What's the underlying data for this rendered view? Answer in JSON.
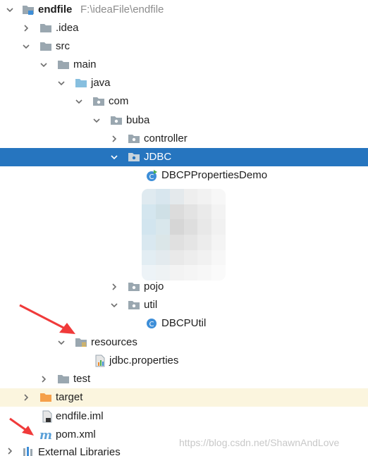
{
  "project": {
    "name": "endfile",
    "path": "F:\\ideaFile\\endfile"
  },
  "tree": {
    "idea": ".idea",
    "src": "src",
    "main": "main",
    "java": "java",
    "com": "com",
    "buba": "buba",
    "controller": "controller",
    "jdbc": "JDBC",
    "dbcp_demo": "DBCPPropertiesDemo",
    "pojo": "pojo",
    "util": "util",
    "dbcp_util": "DBCPUtil",
    "resources": "resources",
    "jdbc_properties": "jdbc.properties",
    "test": "test",
    "target": "target",
    "iml": "endfile.iml",
    "pom": "pom.xml",
    "external_libraries": "External Libraries"
  },
  "selected_item": "JDBC",
  "watermark": "https://blog.csdn.net/ShawnAndLove",
  "colors": {
    "selection": "#2675bf",
    "folder": "#9aa7b0",
    "source_folder": "#87bfdf",
    "target_folder": "#f5a04a",
    "class_icon": "#3d8ed8",
    "arrow": "#f03a3a"
  }
}
